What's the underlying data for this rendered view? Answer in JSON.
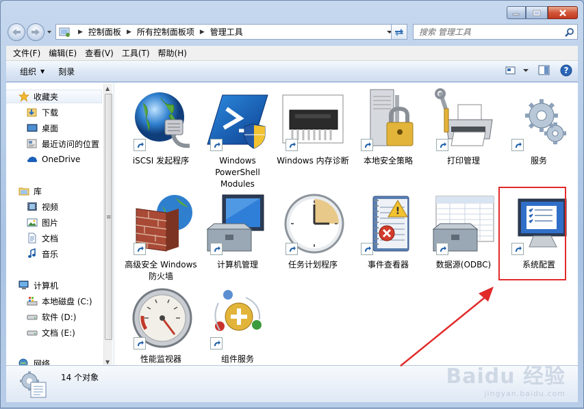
{
  "window": {
    "caption_buttons": [
      "minimize",
      "maximize",
      "close"
    ]
  },
  "address": {
    "crumbs": [
      "控制面板",
      "所有控制面板项",
      "管理工具"
    ],
    "search_placeholder": "搜索 管理工具"
  },
  "menubar": {
    "items": [
      "文件(F)",
      "编辑(E)",
      "查看(V)",
      "工具(T)",
      "帮助(H)"
    ]
  },
  "toolbar": {
    "organize_label": "组织",
    "burn_label": "刻录"
  },
  "nav": {
    "favorites": {
      "label": "收藏夹",
      "items": [
        "下载",
        "桌面",
        "最近访问的位置"
      ]
    },
    "onedrive": "OneDrive",
    "libraries": {
      "label": "库",
      "items": [
        "视频",
        "图片",
        "文档",
        "音乐"
      ]
    },
    "computer": {
      "label": "计算机",
      "items": [
        "本地磁盘 (C:)",
        "软件 (D:)",
        "文档 (E:)"
      ]
    },
    "network": "网络"
  },
  "items": [
    {
      "label": "iSCSI 发起程序",
      "icon": "globe-cable-icon"
    },
    {
      "label": "Windows PowerShell Modules",
      "icon": "powershell-icon"
    },
    {
      "label": "Windows 内存诊断",
      "icon": "memory-chip-icon"
    },
    {
      "label": "本地安全策略",
      "icon": "server-lock-icon"
    },
    {
      "label": "打印管理",
      "icon": "printer-icon"
    },
    {
      "label": "服务",
      "icon": "gears-icon"
    },
    {
      "label": "高级安全 Windows 防火墙",
      "icon": "firewall-icon"
    },
    {
      "label": "计算机管理",
      "icon": "computer-toolbox-icon"
    },
    {
      "label": "任务计划程序",
      "icon": "clock-icon"
    },
    {
      "label": "事件查看器",
      "icon": "event-log-icon"
    },
    {
      "label": "数据源(ODBC)",
      "icon": "database-toolbox-icon"
    },
    {
      "label": "系统配置",
      "icon": "monitor-checklist-icon"
    },
    {
      "label": "性能监视器",
      "icon": "gauge-icon"
    },
    {
      "label": "组件服务",
      "icon": "component-services-icon"
    }
  ],
  "highlighted_item": "系统配置",
  "status": {
    "text": "14 个对象"
  },
  "watermark": {
    "main": "Baidu 经验",
    "sub": "jingyan.baidu.com"
  },
  "colors": {
    "highlight": "#e12a2a",
    "link_blue": "#1f5fa8"
  }
}
